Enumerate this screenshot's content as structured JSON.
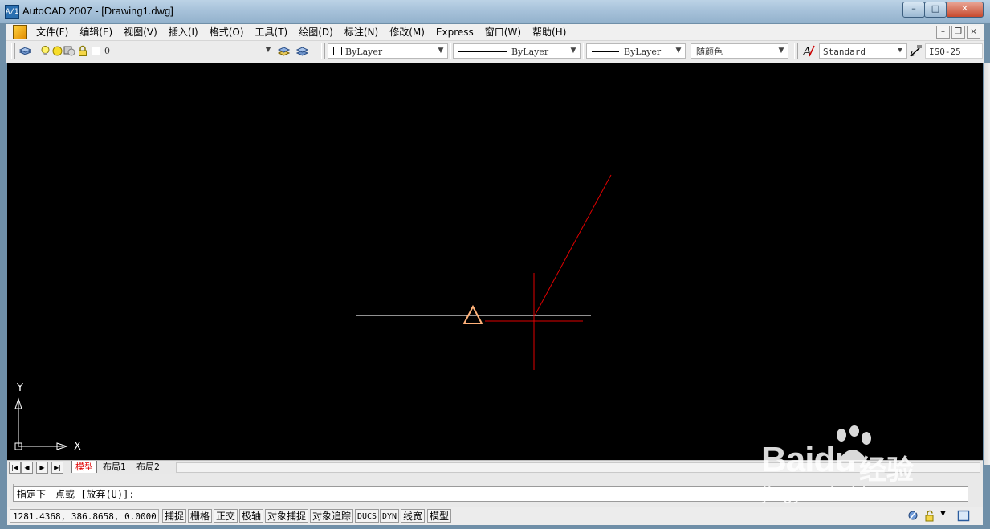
{
  "window": {
    "title": "AutoCAD 2007 - [Drawing1.dwg]",
    "app_icon_label": "A/1",
    "controls": {
      "minimize": "–",
      "maximize": "□",
      "close": "✕"
    }
  },
  "menubar": {
    "items": [
      {
        "label": "文件(F)"
      },
      {
        "label": "编辑(E)"
      },
      {
        "label": "视图(V)"
      },
      {
        "label": "插入(I)"
      },
      {
        "label": "格式(O)"
      },
      {
        "label": "工具(T)"
      },
      {
        "label": "绘图(D)"
      },
      {
        "label": "标注(N)"
      },
      {
        "label": "修改(M)"
      },
      {
        "label": "Express"
      },
      {
        "label": "窗口(W)"
      },
      {
        "label": "帮助(H)"
      }
    ],
    "mdi": {
      "minimize": "–",
      "restore": "❐",
      "close": "×"
    }
  },
  "toolbar": {
    "layer_combo": "0",
    "color_combo": "ByLayer",
    "linetype_combo": "ByLayer",
    "lineweight_combo": "ByLayer",
    "plotstyle_combo": "随颜色",
    "textstyle_combo": "Standard",
    "dimstyle_combo": "ISO-25",
    "dropdown_arrow": "▼"
  },
  "canvas": {
    "ucs_y_label": "Y",
    "ucs_x_label": "X",
    "background": "#000000",
    "cursor_color": "#e00000",
    "line_color": "#e8e8e8",
    "marker_color": "#ffb27a"
  },
  "layout_tabs": {
    "nav": [
      "|◀",
      "◀",
      "▶",
      "▶|"
    ],
    "tabs": [
      {
        "label": "模型",
        "active": true
      },
      {
        "label": "布局1",
        "active": false
      },
      {
        "label": "布局2",
        "active": false
      }
    ]
  },
  "command": {
    "prompt": "指定下一点或 [放弃(U)]:"
  },
  "statusbar": {
    "coords": "1281.4368, 386.8658, 0.0000",
    "buttons": [
      "捕捉",
      "栅格",
      "正交",
      "极轴",
      "对象捕捉",
      "对象追踪",
      "DUCS",
      "DYN",
      "线宽",
      "模型"
    ]
  },
  "watermark": {
    "brand": "Baidu",
    "brand_cn": "经验",
    "url": "jingyan.baidu.com"
  }
}
